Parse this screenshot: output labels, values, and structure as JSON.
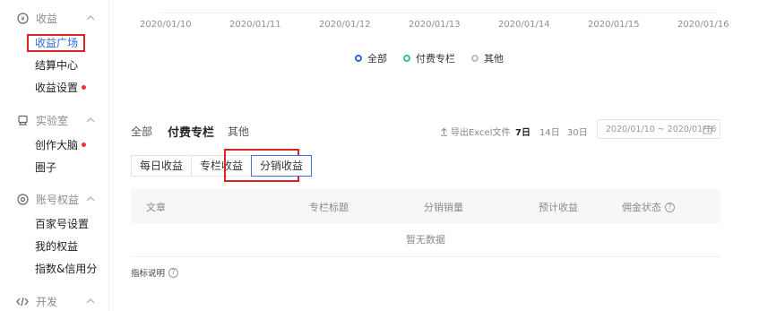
{
  "sidebar": {
    "groups": [
      {
        "label": "收益",
        "icon": "income-icon"
      },
      {
        "label": "实验室",
        "icon": "lab-icon"
      },
      {
        "label": "账号权益",
        "icon": "account-icon"
      },
      {
        "label": "开发",
        "icon": "code-icon"
      }
    ],
    "items": {
      "income_plaza": "收益广场",
      "settlement": "结算中心",
      "income_settings": "收益设置",
      "creative_brain": "创作大脑",
      "circle": "圈子",
      "baijiahao_settings": "百家号设置",
      "my_rights": "我的权益",
      "index_credit": "指数&信用分"
    }
  },
  "chart": {
    "x_ticks": [
      "2020/01/10",
      "2020/01/11",
      "2020/01/12",
      "2020/01/13",
      "2020/01/14",
      "2020/01/15",
      "2020/01/16"
    ],
    "legend": [
      {
        "label": "全部",
        "color": "#2e6bd8"
      },
      {
        "label": "付费专栏",
        "color": "#35c38f"
      },
      {
        "label": "其他",
        "color": "#bbbbbb"
      }
    ]
  },
  "filters": {
    "categories": [
      "全部",
      "付费专栏",
      "其他"
    ],
    "export_label": "导出Excel文件",
    "ranges": [
      "7日",
      "14日",
      "30日"
    ],
    "date_range": "2020/01/10 ~ 2020/01/16"
  },
  "sub_tabs": [
    "每日收益",
    "专栏收益",
    "分销收益"
  ],
  "table": {
    "headers": [
      "文章",
      "专栏标题",
      "分销销量",
      "预计收益",
      "佣金状态"
    ],
    "empty_text": "暂无数据"
  },
  "note_label": "指标说明",
  "colors": {
    "accent": "#2e6bd8",
    "highlight": "#e02020",
    "badge_dot": "#f0323c"
  }
}
